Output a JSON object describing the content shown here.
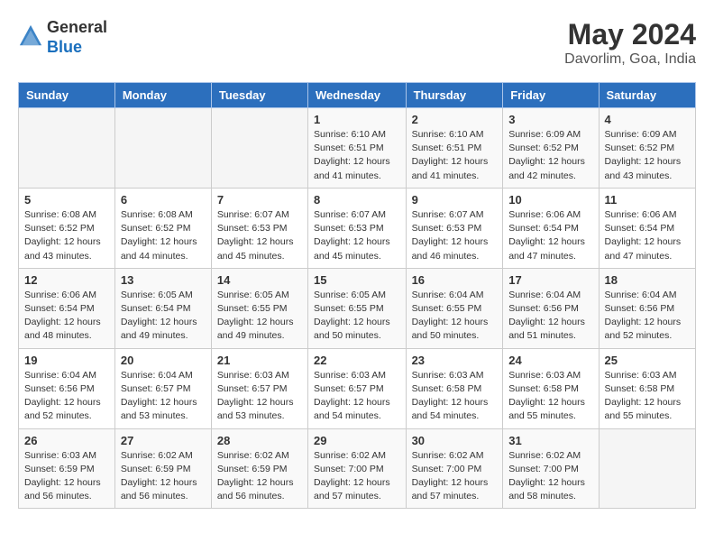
{
  "logo": {
    "general": "General",
    "blue": "Blue"
  },
  "title": "May 2024",
  "location": "Davorlim, Goa, India",
  "days_of_week": [
    "Sunday",
    "Monday",
    "Tuesday",
    "Wednesday",
    "Thursday",
    "Friday",
    "Saturday"
  ],
  "weeks": [
    [
      {
        "day": "",
        "info": ""
      },
      {
        "day": "",
        "info": ""
      },
      {
        "day": "",
        "info": ""
      },
      {
        "day": "1",
        "info": "Sunrise: 6:10 AM\nSunset: 6:51 PM\nDaylight: 12 hours\nand 41 minutes."
      },
      {
        "day": "2",
        "info": "Sunrise: 6:10 AM\nSunset: 6:51 PM\nDaylight: 12 hours\nand 41 minutes."
      },
      {
        "day": "3",
        "info": "Sunrise: 6:09 AM\nSunset: 6:52 PM\nDaylight: 12 hours\nand 42 minutes."
      },
      {
        "day": "4",
        "info": "Sunrise: 6:09 AM\nSunset: 6:52 PM\nDaylight: 12 hours\nand 43 minutes."
      }
    ],
    [
      {
        "day": "5",
        "info": "Sunrise: 6:08 AM\nSunset: 6:52 PM\nDaylight: 12 hours\nand 43 minutes."
      },
      {
        "day": "6",
        "info": "Sunrise: 6:08 AM\nSunset: 6:52 PM\nDaylight: 12 hours\nand 44 minutes."
      },
      {
        "day": "7",
        "info": "Sunrise: 6:07 AM\nSunset: 6:53 PM\nDaylight: 12 hours\nand 45 minutes."
      },
      {
        "day": "8",
        "info": "Sunrise: 6:07 AM\nSunset: 6:53 PM\nDaylight: 12 hours\nand 45 minutes."
      },
      {
        "day": "9",
        "info": "Sunrise: 6:07 AM\nSunset: 6:53 PM\nDaylight: 12 hours\nand 46 minutes."
      },
      {
        "day": "10",
        "info": "Sunrise: 6:06 AM\nSunset: 6:54 PM\nDaylight: 12 hours\nand 47 minutes."
      },
      {
        "day": "11",
        "info": "Sunrise: 6:06 AM\nSunset: 6:54 PM\nDaylight: 12 hours\nand 47 minutes."
      }
    ],
    [
      {
        "day": "12",
        "info": "Sunrise: 6:06 AM\nSunset: 6:54 PM\nDaylight: 12 hours\nand 48 minutes."
      },
      {
        "day": "13",
        "info": "Sunrise: 6:05 AM\nSunset: 6:54 PM\nDaylight: 12 hours\nand 49 minutes."
      },
      {
        "day": "14",
        "info": "Sunrise: 6:05 AM\nSunset: 6:55 PM\nDaylight: 12 hours\nand 49 minutes."
      },
      {
        "day": "15",
        "info": "Sunrise: 6:05 AM\nSunset: 6:55 PM\nDaylight: 12 hours\nand 50 minutes."
      },
      {
        "day": "16",
        "info": "Sunrise: 6:04 AM\nSunset: 6:55 PM\nDaylight: 12 hours\nand 50 minutes."
      },
      {
        "day": "17",
        "info": "Sunrise: 6:04 AM\nSunset: 6:56 PM\nDaylight: 12 hours\nand 51 minutes."
      },
      {
        "day": "18",
        "info": "Sunrise: 6:04 AM\nSunset: 6:56 PM\nDaylight: 12 hours\nand 52 minutes."
      }
    ],
    [
      {
        "day": "19",
        "info": "Sunrise: 6:04 AM\nSunset: 6:56 PM\nDaylight: 12 hours\nand 52 minutes."
      },
      {
        "day": "20",
        "info": "Sunrise: 6:04 AM\nSunset: 6:57 PM\nDaylight: 12 hours\nand 53 minutes."
      },
      {
        "day": "21",
        "info": "Sunrise: 6:03 AM\nSunset: 6:57 PM\nDaylight: 12 hours\nand 53 minutes."
      },
      {
        "day": "22",
        "info": "Sunrise: 6:03 AM\nSunset: 6:57 PM\nDaylight: 12 hours\nand 54 minutes."
      },
      {
        "day": "23",
        "info": "Sunrise: 6:03 AM\nSunset: 6:58 PM\nDaylight: 12 hours\nand 54 minutes."
      },
      {
        "day": "24",
        "info": "Sunrise: 6:03 AM\nSunset: 6:58 PM\nDaylight: 12 hours\nand 55 minutes."
      },
      {
        "day": "25",
        "info": "Sunrise: 6:03 AM\nSunset: 6:58 PM\nDaylight: 12 hours\nand 55 minutes."
      }
    ],
    [
      {
        "day": "26",
        "info": "Sunrise: 6:03 AM\nSunset: 6:59 PM\nDaylight: 12 hours\nand 56 minutes."
      },
      {
        "day": "27",
        "info": "Sunrise: 6:02 AM\nSunset: 6:59 PM\nDaylight: 12 hours\nand 56 minutes."
      },
      {
        "day": "28",
        "info": "Sunrise: 6:02 AM\nSunset: 6:59 PM\nDaylight: 12 hours\nand 56 minutes."
      },
      {
        "day": "29",
        "info": "Sunrise: 6:02 AM\nSunset: 7:00 PM\nDaylight: 12 hours\nand 57 minutes."
      },
      {
        "day": "30",
        "info": "Sunrise: 6:02 AM\nSunset: 7:00 PM\nDaylight: 12 hours\nand 57 minutes."
      },
      {
        "day": "31",
        "info": "Sunrise: 6:02 AM\nSunset: 7:00 PM\nDaylight: 12 hours\nand 58 minutes."
      },
      {
        "day": "",
        "info": ""
      }
    ]
  ]
}
